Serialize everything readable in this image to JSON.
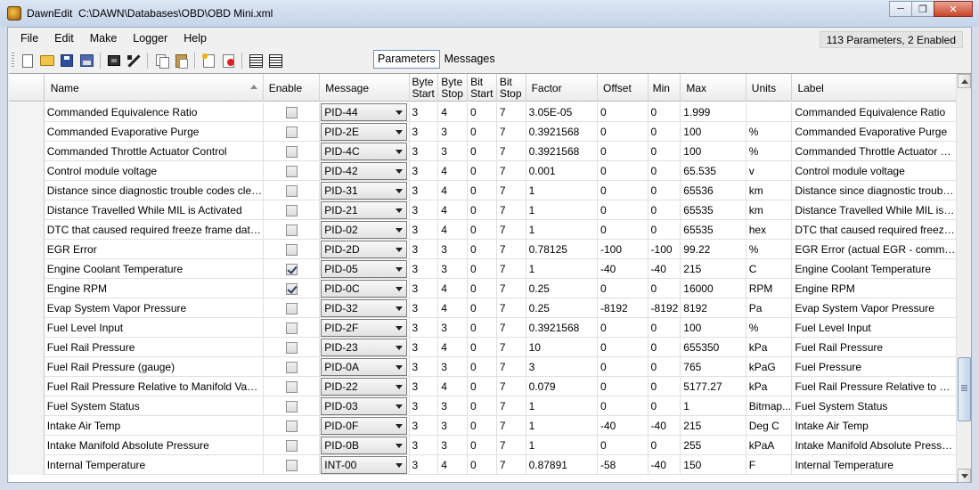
{
  "window": {
    "app_name": "DawnEdit",
    "file_path": "C:\\DAWN\\Databases\\OBD\\OBD Mini.xml"
  },
  "menu": [
    "File",
    "Edit",
    "Make",
    "Logger",
    "Help"
  ],
  "status": "113 Parameters, 2 Enabled",
  "toolbar": {
    "icons": [
      "new-file-icon",
      "open-folder-icon",
      "save-icon",
      "save-as-icon",
      "chip-icon",
      "wand-icon",
      "copy-icon",
      "paste-icon",
      "add-row-icon",
      "delete-row-icon",
      "grid-view-icon",
      "grid-export-icon"
    ]
  },
  "view_tabs": [
    {
      "label": "Parameters",
      "active": true
    },
    {
      "label": "Messages",
      "active": false
    }
  ],
  "columns": {
    "name": "Name",
    "enable": "Enable",
    "message": "Message",
    "byte_start": [
      "Byte",
      "Start"
    ],
    "byte_stop": [
      "Byte",
      "Stop"
    ],
    "bit_start": [
      "Bit",
      "Start"
    ],
    "bit_stop": [
      "Bit",
      "Stop"
    ],
    "factor": "Factor",
    "offset": "Offset",
    "min": "Min",
    "max": "Max",
    "units": "Units",
    "label": "Label"
  },
  "rows": [
    {
      "name": "Commanded Equivalence Ratio",
      "enabled": false,
      "message": "PID-44",
      "byte_start": "3",
      "byte_stop": "4",
      "bit_start": "0",
      "bit_stop": "7",
      "factor": "3.05E-05",
      "offset": "0",
      "min": "0",
      "max": "1.999",
      "units": "",
      "label": "Commanded Equivalence Ratio"
    },
    {
      "name": "Commanded Evaporative Purge",
      "enabled": false,
      "message": "PID-2E",
      "byte_start": "3",
      "byte_stop": "3",
      "bit_start": "0",
      "bit_stop": "7",
      "factor": "0.3921568",
      "offset": "0",
      "min": "0",
      "max": "100",
      "units": "%",
      "label": "Commanded Evaporative Purge"
    },
    {
      "name": "Commanded Throttle Actuator Control",
      "enabled": false,
      "message": "PID-4C",
      "byte_start": "3",
      "byte_stop": "3",
      "bit_start": "0",
      "bit_stop": "7",
      "factor": "0.3921568",
      "offset": "0",
      "min": "0",
      "max": "100",
      "units": "%",
      "label": "Commanded Throttle Actuator Control"
    },
    {
      "name": "Control module voltage",
      "enabled": false,
      "message": "PID-42",
      "byte_start": "3",
      "byte_stop": "4",
      "bit_start": "0",
      "bit_stop": "7",
      "factor": "0.001",
      "offset": "0",
      "min": "0",
      "max": "65.535",
      "units": "v",
      "label": "Control module voltage"
    },
    {
      "name": "Distance since diagnostic trouble codes cleared",
      "enabled": false,
      "message": "PID-31",
      "byte_start": "3",
      "byte_stop": "4",
      "bit_start": "0",
      "bit_stop": "7",
      "factor": "1",
      "offset": "0",
      "min": "0",
      "max": "65536",
      "units": "km",
      "label": "Distance since diagnostic trouble c..."
    },
    {
      "name": "Distance Travelled While MIL is Activated",
      "enabled": false,
      "message": "PID-21",
      "byte_start": "3",
      "byte_stop": "4",
      "bit_start": "0",
      "bit_stop": "7",
      "factor": "1",
      "offset": "0",
      "min": "0",
      "max": "65535",
      "units": "km",
      "label": "Distance Travelled While MIL is Ac..."
    },
    {
      "name": "DTC that caused required freeze frame data sto...",
      "enabled": false,
      "message": "PID-02",
      "byte_start": "3",
      "byte_stop": "4",
      "bit_start": "0",
      "bit_stop": "7",
      "factor": "1",
      "offset": "0",
      "min": "0",
      "max": "65535",
      "units": "hex",
      "label": "DTC that caused required freeze fr..."
    },
    {
      "name": "EGR Error",
      "enabled": false,
      "message": "PID-2D",
      "byte_start": "3",
      "byte_stop": "3",
      "bit_start": "0",
      "bit_stop": "7",
      "factor": "0.78125",
      "offset": "-100",
      "min": "-100",
      "max": "99.22",
      "units": "%",
      "label": "EGR Error (actual EGR - command..."
    },
    {
      "name": "Engine Coolant Temperature",
      "enabled": true,
      "message": "PID-05",
      "byte_start": "3",
      "byte_stop": "3",
      "bit_start": "0",
      "bit_stop": "7",
      "factor": "1",
      "offset": "-40",
      "min": "-40",
      "max": "215",
      "units": "C",
      "label": "Engine Coolant Temperature"
    },
    {
      "name": "Engine RPM",
      "enabled": true,
      "message": "PID-0C",
      "byte_start": "3",
      "byte_stop": "4",
      "bit_start": "0",
      "bit_stop": "7",
      "factor": "0.25",
      "offset": "0",
      "min": "0",
      "max": "16000",
      "units": "RPM",
      "label": "Engine RPM"
    },
    {
      "name": "Evap System Vapor Pressure",
      "enabled": false,
      "message": "PID-32",
      "byte_start": "3",
      "byte_stop": "4",
      "bit_start": "0",
      "bit_stop": "7",
      "factor": "0.25",
      "offset": "-8192",
      "min": "-8192",
      "max": "8192",
      "units": "Pa",
      "label": "Evap System Vapor Pressure"
    },
    {
      "name": "Fuel Level Input",
      "enabled": false,
      "message": "PID-2F",
      "byte_start": "3",
      "byte_stop": "3",
      "bit_start": "0",
      "bit_stop": "7",
      "factor": "0.3921568",
      "offset": "0",
      "min": "0",
      "max": "100",
      "units": "%",
      "label": "Fuel Level Input"
    },
    {
      "name": "Fuel Rail Pressure",
      "enabled": false,
      "message": "PID-23",
      "byte_start": "3",
      "byte_stop": "4",
      "bit_start": "0",
      "bit_stop": "7",
      "factor": "10",
      "offset": "0",
      "min": "0",
      "max": "655350",
      "units": "kPa",
      "label": "Fuel Rail Pressure"
    },
    {
      "name": "Fuel Rail Pressure (gauge)",
      "enabled": false,
      "message": "PID-0A",
      "byte_start": "3",
      "byte_stop": "3",
      "bit_start": "0",
      "bit_stop": "7",
      "factor": "3",
      "offset": "0",
      "min": "0",
      "max": "765",
      "units": "kPaG",
      "label": "Fuel Pressure"
    },
    {
      "name": "Fuel Rail Pressure Relative to Manifold Vacuum",
      "enabled": false,
      "message": "PID-22",
      "byte_start": "3",
      "byte_stop": "4",
      "bit_start": "0",
      "bit_stop": "7",
      "factor": "0.079",
      "offset": "0",
      "min": "0",
      "max": "5177.27",
      "units": "kPa",
      "label": "Fuel Rail Pressure Relative to Manif..."
    },
    {
      "name": "Fuel System Status",
      "enabled": false,
      "message": "PID-03",
      "byte_start": "3",
      "byte_stop": "3",
      "bit_start": "0",
      "bit_stop": "7",
      "factor": "1",
      "offset": "0",
      "min": "0",
      "max": "1",
      "units": "Bitmap...",
      "label": "Fuel System Status"
    },
    {
      "name": "Intake Air Temp",
      "enabled": false,
      "message": "PID-0F",
      "byte_start": "3",
      "byte_stop": "3",
      "bit_start": "0",
      "bit_stop": "7",
      "factor": "1",
      "offset": "-40",
      "min": "-40",
      "max": "215",
      "units": "Deg C",
      "label": "Intake Air Temp"
    },
    {
      "name": "Intake Manifold Absolute Pressure",
      "enabled": false,
      "message": "PID-0B",
      "byte_start": "3",
      "byte_stop": "3",
      "bit_start": "0",
      "bit_stop": "7",
      "factor": "1",
      "offset": "0",
      "min": "0",
      "max": "255",
      "units": "kPaA",
      "label": "Intake Manifold Absolute Pressure"
    },
    {
      "name": "Internal Temperature",
      "enabled": false,
      "message": "INT-00",
      "byte_start": "3",
      "byte_stop": "4",
      "bit_start": "0",
      "bit_stop": "7",
      "factor": "0.87891",
      "offset": "-58",
      "min": "-40",
      "max": "150",
      "units": "F",
      "label": "Internal Temperature"
    }
  ]
}
